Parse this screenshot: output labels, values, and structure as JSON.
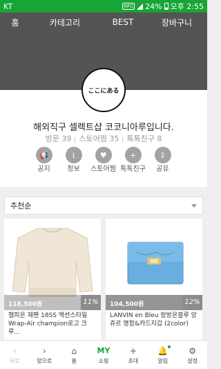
{
  "status_bar": {
    "carrier": "KT",
    "nfc": "NFC",
    "battery": "24%",
    "time": "오후 2:55"
  },
  "top_nav": {
    "tabs": [
      "홈",
      "카테고리",
      "BEST",
      "장바구니"
    ]
  },
  "profile": {
    "logo_text": "ここにある",
    "store_name": "해외직구 셀렉트샵 코코니아루입니다.",
    "stats": [
      "방문 39",
      "스토어찜 35",
      "톡톡친구 8"
    ],
    "actions": [
      {
        "label": "공지",
        "icon": "megaphone-icon",
        "glyph": "📢"
      },
      {
        "label": "정보",
        "icon": "info-icon",
        "glyph": "i"
      },
      {
        "label": "스토어찜",
        "icon": "store-bookmark-icon",
        "glyph": "♥"
      },
      {
        "label": "톡톡친구",
        "icon": "chat-add-icon",
        "glyph": "+"
      },
      {
        "label": "공유",
        "icon": "share-icon",
        "glyph": "⇪"
      }
    ]
  },
  "sort": {
    "selected": "추천순"
  },
  "products": [
    {
      "price": "118,500원",
      "discount": "11%",
      "title": "챔피온 재팬 18SS 액션스타일 Wrap-Air champion로고 크루..."
    },
    {
      "price": "104,500원",
      "discount": "12%",
      "title": "LANVIN en Bleu 랑방온블루 앙쥬르 명함&카드지갑 (2color)"
    }
  ],
  "bottom_nav": [
    {
      "label": "뒤로",
      "icon": "back-icon",
      "glyph": "‹"
    },
    {
      "label": "앞으로",
      "icon": "forward-icon",
      "glyph": "›"
    },
    {
      "label": "홈",
      "icon": "home-icon",
      "glyph": "⌂"
    },
    {
      "label": "쇼핑",
      "icon": "my-icon",
      "glyph": "MY"
    },
    {
      "label": "초대",
      "icon": "invite-icon",
      "glyph": "+"
    },
    {
      "label": "알림",
      "icon": "bell-icon",
      "glyph": "🔔"
    },
    {
      "label": "설정",
      "icon": "gear-icon",
      "glyph": "⚙"
    }
  ],
  "colors": {
    "status_green": "#17a535",
    "accent_green": "#1aa33a",
    "cover_gray": "#545454"
  }
}
